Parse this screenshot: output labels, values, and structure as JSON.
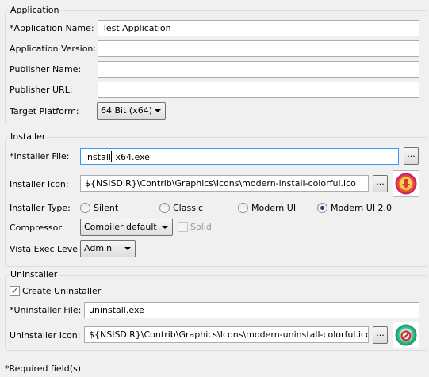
{
  "application": {
    "title": "Application",
    "name_label": "*Application Name:",
    "name_value": "Test Application",
    "version_label": "Application Version:",
    "version_value": "",
    "publisher_name_label": "Publisher Name:",
    "publisher_name_value": "",
    "publisher_url_label": "Publisher URL:",
    "publisher_url_value": "",
    "target_platform_label": "Target Platform:",
    "target_platform_value": "64 Bit (x64)"
  },
  "installer": {
    "title": "Installer",
    "file_label": "*Installer File:",
    "file_value_before_caret": "install",
    "file_value_after_caret": "_x64.exe",
    "browse_label": "...",
    "icon_label": "Installer Icon:",
    "icon_value": "${NSISDIR}\\Contrib\\Graphics\\Icons\\modern-install-colorful.ico",
    "icon_browse_label": "...",
    "icon_preview": "modern-install-colorful-icon",
    "type_label": "Installer Type:",
    "type_options": [
      {
        "label": "Silent",
        "checked": false
      },
      {
        "label": "Classic",
        "checked": false
      },
      {
        "label": "Modern UI",
        "checked": false
      },
      {
        "label": "Modern UI 2.0",
        "checked": true
      }
    ],
    "compressor_label": "Compressor:",
    "compressor_value": "Compiler default",
    "solid_label": "Solid",
    "solid_checked": false,
    "vista_label": "Vista Exec Level:",
    "vista_value": "Admin"
  },
  "uninstaller": {
    "title": "Uninstaller",
    "create_label": "Create Uninstaller",
    "create_checked": true,
    "file_label": "*Uninstaller File:",
    "file_value": "uninstall.exe",
    "icon_label": "Uninstaller Icon:",
    "icon_value": "${NSISDIR}\\Contrib\\Graphics\\Icons\\modern-uninstall-colorful.ico",
    "icon_browse_label": "...",
    "icon_preview": "modern-uninstall-colorful-icon"
  },
  "footer": {
    "required_note": "*Required field(s)"
  },
  "colors": {
    "background": "#f0f0f0",
    "group_border": "#d5dfe5",
    "focus_border": "#3399ff",
    "radio_dot": "#1f3f77"
  }
}
